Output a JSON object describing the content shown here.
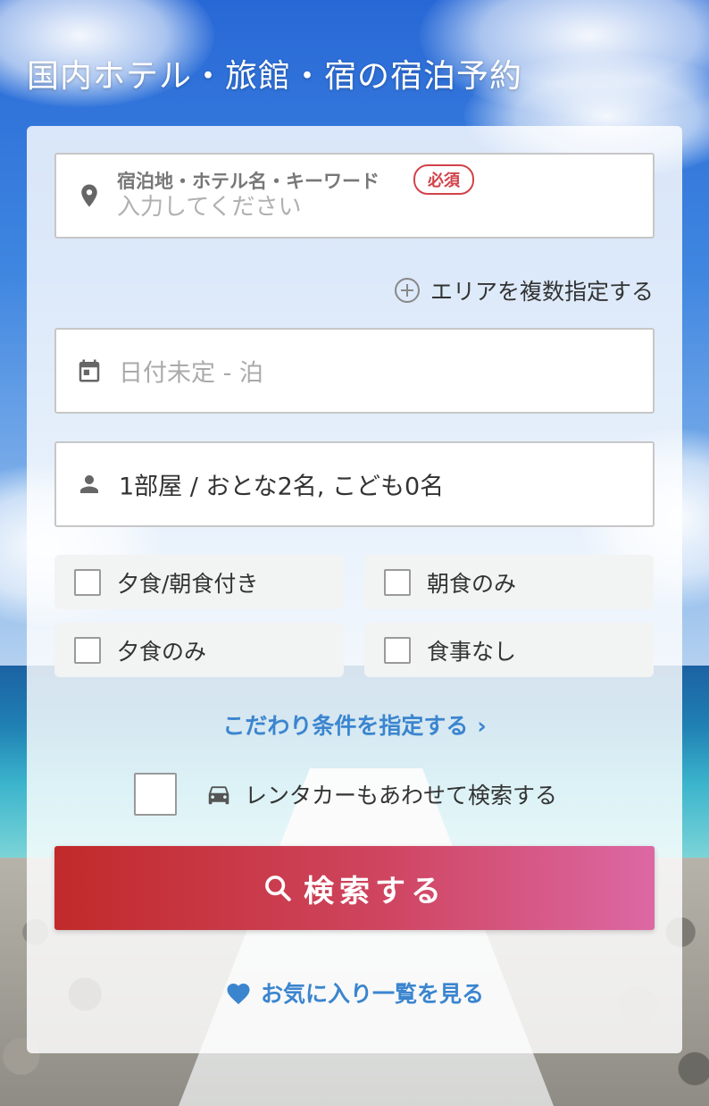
{
  "page": {
    "title": "国内ホテル・旅館・宿の宿泊予約"
  },
  "keyword": {
    "label": "宿泊地・ホテル名・キーワード",
    "required_badge": "必須",
    "placeholder": "入力してください",
    "icon": "map-pin-icon"
  },
  "multi_area": {
    "label": "エリアを複数指定する",
    "icon": "plus-circle-icon"
  },
  "date": {
    "value": "日付未定 - 泊",
    "icon": "calendar-icon"
  },
  "guests": {
    "value": "1部屋 / おとな2名, こども0名",
    "icon": "person-icon"
  },
  "meals": [
    {
      "label": "夕食/朝食付き",
      "checked": false
    },
    {
      "label": "朝食のみ",
      "checked": false
    },
    {
      "label": "夕食のみ",
      "checked": false
    },
    {
      "label": "食事なし",
      "checked": false
    }
  ],
  "preferences": {
    "label": "こだわり条件を指定する",
    "chevron": "›"
  },
  "rental_car": {
    "label": "レンタカーもあわせて検索する",
    "checked": false,
    "icon": "car-icon"
  },
  "search": {
    "label": "検索する",
    "icon": "search-icon"
  },
  "favorites": {
    "label": "お気に入り一覧を見る",
    "icon": "heart-icon"
  },
  "colors": {
    "link": "#3b85cf",
    "required": "#d2424a",
    "button_start": "#c12a2a",
    "button_end": "#dc68a4"
  }
}
